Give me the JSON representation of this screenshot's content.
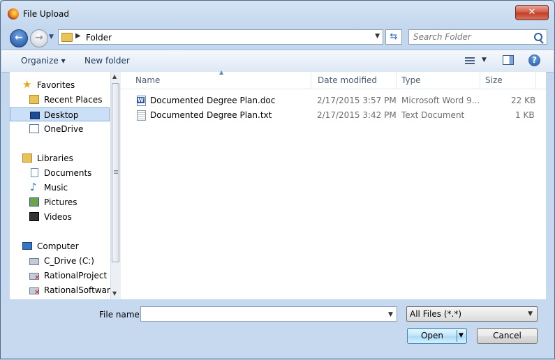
{
  "window": {
    "title": "File Upload",
    "close_label": "✕"
  },
  "nav": {
    "address_path": "Folder",
    "search_placeholder": "Search Folder"
  },
  "toolbar": {
    "organize_label": "Organize ▾",
    "new_folder_label": "New folder"
  },
  "sidebar": {
    "favorites": {
      "label": "Favorites",
      "items": [
        {
          "label": "Recent Places"
        },
        {
          "label": "Desktop"
        },
        {
          "label": "OneDrive"
        }
      ]
    },
    "libraries": {
      "label": "Libraries",
      "items": [
        {
          "label": "Documents"
        },
        {
          "label": "Music"
        },
        {
          "label": "Pictures"
        },
        {
          "label": "Videos"
        }
      ]
    },
    "computer": {
      "label": "Computer",
      "items": [
        {
          "label": "C_Drive (C:)"
        },
        {
          "label": "RationalProject (\\\\"
        },
        {
          "label": "RationalSoftware_"
        }
      ]
    }
  },
  "columns": {
    "name": "Name",
    "date": "Date modified",
    "type": "Type",
    "size": "Size"
  },
  "files": [
    {
      "name": "Documented Degree Plan.doc",
      "date": "2/17/2015 3:57 PM",
      "type": "Microsoft Word 9...",
      "size": "22 KB",
      "icon": "word-doc-icon"
    },
    {
      "name": "Documented Degree Plan.txt",
      "date": "2/17/2015 3:42 PM",
      "type": "Text Document",
      "size": "1 KB",
      "icon": "text-doc-icon"
    }
  ],
  "footer": {
    "file_name_label": "File name:",
    "file_name_value": "",
    "file_type": "All Files (*.*)",
    "open_label": "Open",
    "cancel_label": "Cancel"
  }
}
